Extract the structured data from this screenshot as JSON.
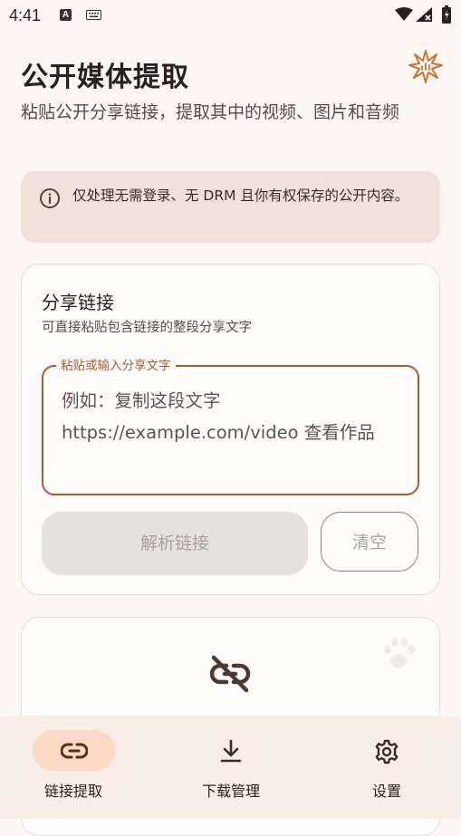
{
  "status_bar": {
    "time": "4:41",
    "a_badge": "A"
  },
  "header": {
    "title": "公开媒体提取",
    "subtitle": "粘贴公开分享链接，提取其中的视频、图片和音频"
  },
  "notice": {
    "text": "仅处理无需登录、无 DRM 且你有权保存的公开内容。"
  },
  "share_card": {
    "title": "分享链接",
    "hint": "可直接粘贴包含链接的整段分享文字",
    "field_label": "粘贴或输入分享文字",
    "field_placeholder": "例如：复制这段文字\nhttps://example.com/video 查看作品",
    "parse_button": "解析链接",
    "clear_button": "清空"
  },
  "bottom_nav": {
    "items": [
      {
        "label": "链接提取",
        "icon": "link-icon",
        "active": true
      },
      {
        "label": "下载管理",
        "icon": "download-icon",
        "active": false
      },
      {
        "label": "设置",
        "icon": "gear-icon",
        "active": false
      }
    ]
  },
  "colors": {
    "accent": "#A85B2E",
    "background": "#FCF7F3",
    "notice_bg": "#F0E0DA",
    "nav_active_pill": "#FCD9C6"
  }
}
